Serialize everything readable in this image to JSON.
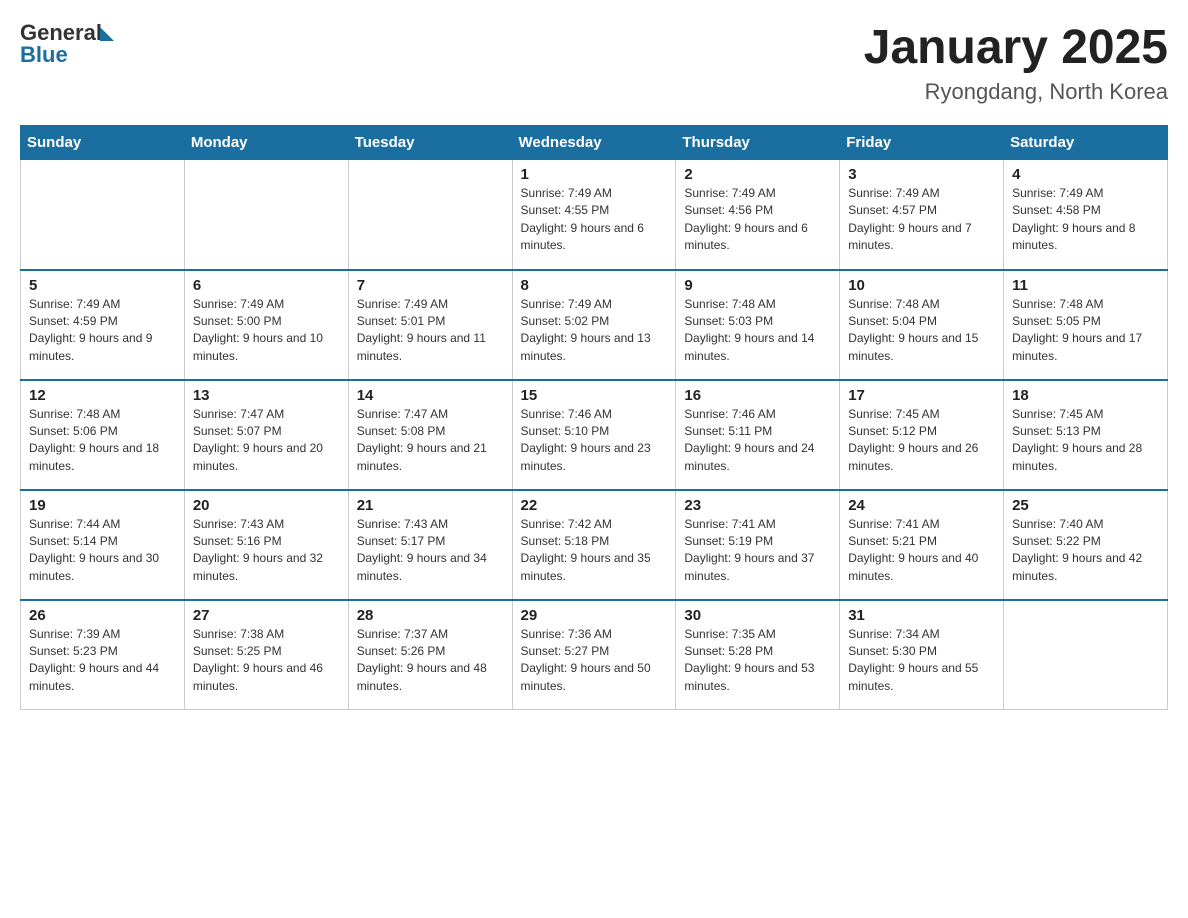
{
  "header": {
    "logo_general": "General",
    "logo_blue": "Blue",
    "title": "January 2025",
    "subtitle": "Ryongdang, North Korea"
  },
  "days_of_week": [
    "Sunday",
    "Monday",
    "Tuesday",
    "Wednesday",
    "Thursday",
    "Friday",
    "Saturday"
  ],
  "weeks": [
    [
      null,
      null,
      null,
      {
        "day": 1,
        "sunrise": "7:49 AM",
        "sunset": "4:55 PM",
        "daylight": "9 hours and 6 minutes."
      },
      {
        "day": 2,
        "sunrise": "7:49 AM",
        "sunset": "4:56 PM",
        "daylight": "9 hours and 6 minutes."
      },
      {
        "day": 3,
        "sunrise": "7:49 AM",
        "sunset": "4:57 PM",
        "daylight": "9 hours and 7 minutes."
      },
      {
        "day": 4,
        "sunrise": "7:49 AM",
        "sunset": "4:58 PM",
        "daylight": "9 hours and 8 minutes."
      }
    ],
    [
      {
        "day": 5,
        "sunrise": "7:49 AM",
        "sunset": "4:59 PM",
        "daylight": "9 hours and 9 minutes."
      },
      {
        "day": 6,
        "sunrise": "7:49 AM",
        "sunset": "5:00 PM",
        "daylight": "9 hours and 10 minutes."
      },
      {
        "day": 7,
        "sunrise": "7:49 AM",
        "sunset": "5:01 PM",
        "daylight": "9 hours and 11 minutes."
      },
      {
        "day": 8,
        "sunrise": "7:49 AM",
        "sunset": "5:02 PM",
        "daylight": "9 hours and 13 minutes."
      },
      {
        "day": 9,
        "sunrise": "7:48 AM",
        "sunset": "5:03 PM",
        "daylight": "9 hours and 14 minutes."
      },
      {
        "day": 10,
        "sunrise": "7:48 AM",
        "sunset": "5:04 PM",
        "daylight": "9 hours and 15 minutes."
      },
      {
        "day": 11,
        "sunrise": "7:48 AM",
        "sunset": "5:05 PM",
        "daylight": "9 hours and 17 minutes."
      }
    ],
    [
      {
        "day": 12,
        "sunrise": "7:48 AM",
        "sunset": "5:06 PM",
        "daylight": "9 hours and 18 minutes."
      },
      {
        "day": 13,
        "sunrise": "7:47 AM",
        "sunset": "5:07 PM",
        "daylight": "9 hours and 20 minutes."
      },
      {
        "day": 14,
        "sunrise": "7:47 AM",
        "sunset": "5:08 PM",
        "daylight": "9 hours and 21 minutes."
      },
      {
        "day": 15,
        "sunrise": "7:46 AM",
        "sunset": "5:10 PM",
        "daylight": "9 hours and 23 minutes."
      },
      {
        "day": 16,
        "sunrise": "7:46 AM",
        "sunset": "5:11 PM",
        "daylight": "9 hours and 24 minutes."
      },
      {
        "day": 17,
        "sunrise": "7:45 AM",
        "sunset": "5:12 PM",
        "daylight": "9 hours and 26 minutes."
      },
      {
        "day": 18,
        "sunrise": "7:45 AM",
        "sunset": "5:13 PM",
        "daylight": "9 hours and 28 minutes."
      }
    ],
    [
      {
        "day": 19,
        "sunrise": "7:44 AM",
        "sunset": "5:14 PM",
        "daylight": "9 hours and 30 minutes."
      },
      {
        "day": 20,
        "sunrise": "7:43 AM",
        "sunset": "5:16 PM",
        "daylight": "9 hours and 32 minutes."
      },
      {
        "day": 21,
        "sunrise": "7:43 AM",
        "sunset": "5:17 PM",
        "daylight": "9 hours and 34 minutes."
      },
      {
        "day": 22,
        "sunrise": "7:42 AM",
        "sunset": "5:18 PM",
        "daylight": "9 hours and 35 minutes."
      },
      {
        "day": 23,
        "sunrise": "7:41 AM",
        "sunset": "5:19 PM",
        "daylight": "9 hours and 37 minutes."
      },
      {
        "day": 24,
        "sunrise": "7:41 AM",
        "sunset": "5:21 PM",
        "daylight": "9 hours and 40 minutes."
      },
      {
        "day": 25,
        "sunrise": "7:40 AM",
        "sunset": "5:22 PM",
        "daylight": "9 hours and 42 minutes."
      }
    ],
    [
      {
        "day": 26,
        "sunrise": "7:39 AM",
        "sunset": "5:23 PM",
        "daylight": "9 hours and 44 minutes."
      },
      {
        "day": 27,
        "sunrise": "7:38 AM",
        "sunset": "5:25 PM",
        "daylight": "9 hours and 46 minutes."
      },
      {
        "day": 28,
        "sunrise": "7:37 AM",
        "sunset": "5:26 PM",
        "daylight": "9 hours and 48 minutes."
      },
      {
        "day": 29,
        "sunrise": "7:36 AM",
        "sunset": "5:27 PM",
        "daylight": "9 hours and 50 minutes."
      },
      {
        "day": 30,
        "sunrise": "7:35 AM",
        "sunset": "5:28 PM",
        "daylight": "9 hours and 53 minutes."
      },
      {
        "day": 31,
        "sunrise": "7:34 AM",
        "sunset": "5:30 PM",
        "daylight": "9 hours and 55 minutes."
      },
      null
    ]
  ]
}
